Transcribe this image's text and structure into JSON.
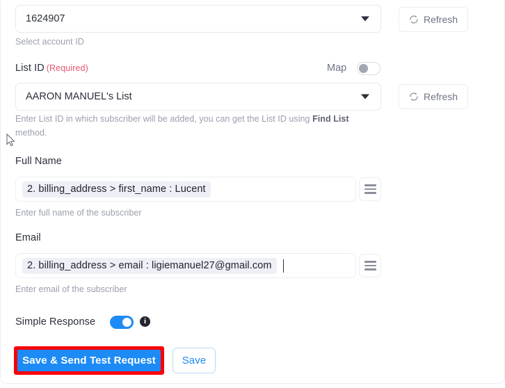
{
  "account": {
    "selected_value": "1624907",
    "helper": "Select account ID",
    "refresh_label": "Refresh",
    "refresh_icon": "refresh-icon",
    "caret_icon": "chevron-down-icon"
  },
  "list_id": {
    "label": "List ID",
    "required_tag": "(Required)",
    "map_label": "Map",
    "map_toggle_state": "off",
    "selected_value": "AARON MANUEL's List",
    "helper_part1": "Enter List ID in which subscriber will be added, you can get the List ID using ",
    "helper_link": "Find List",
    "helper_part2": " method.",
    "refresh_label": "Refresh",
    "refresh_icon": "refresh-icon",
    "caret_icon": "chevron-down-icon"
  },
  "full_name": {
    "label": "Full Name",
    "token": "2. billing_address > first_name : Lucent",
    "helper": "Enter full name of the subscriber",
    "menu_icon": "hamburger-icon"
  },
  "email": {
    "label": "Email",
    "token": "2. billing_address > email : ligiemanuel27@gmail.com",
    "helper": "Enter email of the subscriber",
    "menu_icon": "hamburger-icon"
  },
  "simple_response": {
    "label": "Simple Response",
    "toggle_state": "on",
    "info_icon": "info-icon",
    "info_glyph": "i"
  },
  "actions": {
    "primary_label": "Save & Send Test Request",
    "secondary_label": "Save"
  },
  "colors": {
    "accent_blue": "#1d8bf5",
    "highlight_red": "#fb0007",
    "required_red": "#e8566f",
    "token_bg": "#eef0f6",
    "helper_gray": "#9b9fad",
    "border_gray": "#eceef3"
  }
}
